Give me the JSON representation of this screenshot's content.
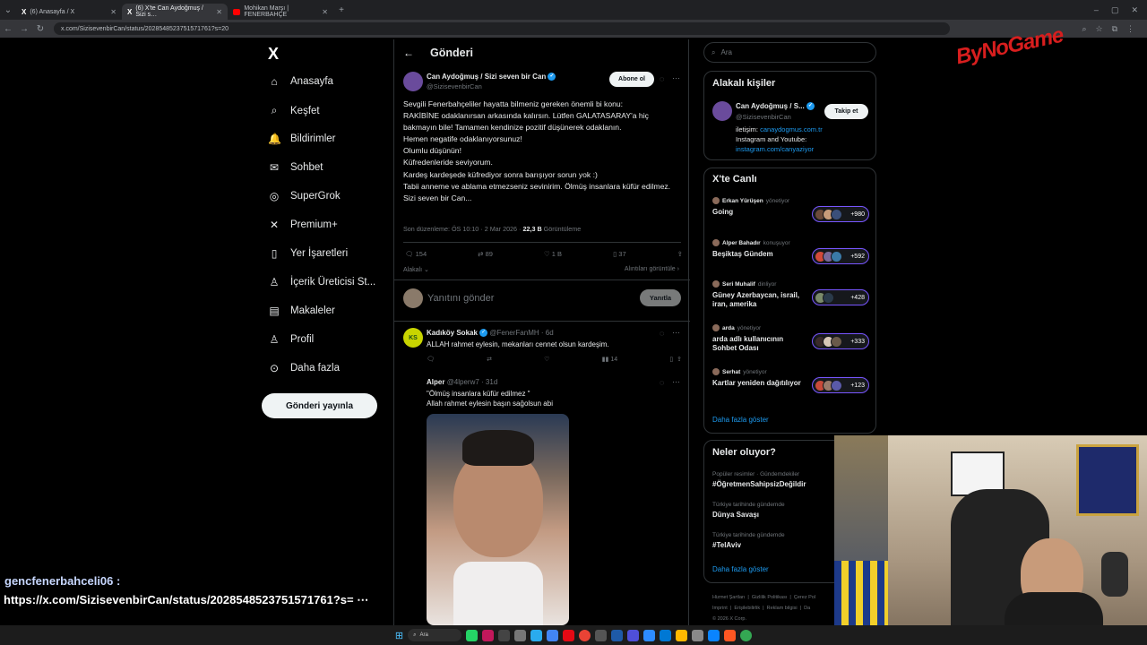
{
  "browser": {
    "tabs": [
      {
        "label": "(6) Anasayfa / X",
        "icon": "x-logo-icon",
        "active": false
      },
      {
        "label": "(6) X'te Can Aydoğmuş / Sizi s…",
        "icon": "x-logo-icon",
        "active": true
      },
      {
        "label": "Mohikan Marşı | FENERBAHÇE",
        "icon": "youtube-icon",
        "active": false
      }
    ],
    "new_tab": "+",
    "url": "x.com/SizisevenbirCan/status/2028548523751571761?s=20"
  },
  "sidebar": {
    "logo": "X",
    "items": [
      {
        "label": "Anasayfa",
        "icon": "home-icon",
        "glyph": "⌂"
      },
      {
        "label": "Keşfet",
        "icon": "search-icon",
        "glyph": "⌕"
      },
      {
        "label": "Bildirimler",
        "icon": "bell-icon",
        "glyph": "🔔"
      },
      {
        "label": "Sohbet",
        "icon": "mail-icon",
        "glyph": "✉"
      },
      {
        "label": "SuperGrok",
        "icon": "grok-icon",
        "glyph": "◎"
      },
      {
        "label": "Premium+",
        "icon": "premium-icon",
        "glyph": "✕"
      },
      {
        "label": "Yer İşaretleri",
        "icon": "bookmark-icon",
        "glyph": "▯"
      },
      {
        "label": "İçerik Üreticisi St...",
        "icon": "creator-icon",
        "glyph": "♙"
      },
      {
        "label": "Makaleler",
        "icon": "article-icon",
        "glyph": "▤"
      },
      {
        "label": "Profil",
        "icon": "profile-icon",
        "glyph": "♙"
      },
      {
        "label": "Daha fazla",
        "icon": "more-circle-icon",
        "glyph": "⊙"
      }
    ],
    "post_button": "Gönderi yayınla"
  },
  "main": {
    "header": {
      "back": "←",
      "title": "Gönderi"
    },
    "post": {
      "author": "Can Aydoğmuş / Sizi seven bir Can",
      "handle": "@SizisevenbirCan",
      "subscribe": "Abone ol",
      "body": "Sevgili Fenerbahçeliler hayatta bilmeniz gereken önemli bi konu:\nRAKİBİNE odaklanırsan arkasında kalırsın. Lütfen GALATASARAY'a hiç bakmayın bile! Tamamen kendinize pozitif düşünerek odaklanın.\nHemen negatife odaklanıyorsunuz!\nOlumlu düşünün!\nKüfredenleride seviyorum.\nKardeş kardeşede küfrediyor sonra barışıyor sorun yok :)\nTabii anneme ve ablama etmezseniz sevinirim. Ölmüş insanlara küfür edilmez.\nSizi seven bir Can...",
      "edited": "Son düzenleme: ÖS 10:10 · 2 Mar 2026 · ",
      "views_count": "22,3 B",
      "views_label": " Görüntüleme",
      "stats": {
        "replies": "154",
        "reposts": "89",
        "likes": "1 B",
        "bookmarks": "37"
      },
      "sort": "Alakalı",
      "quotes_link": "Alıntıları görüntüle"
    },
    "reply_box": {
      "placeholder": "Yanıtını gönder",
      "button": "Yanıtla"
    },
    "replies": [
      {
        "author": "Kadıköy Sokak",
        "handle": "@FenerFanMH · 6d",
        "text": "ALLAH rahmet eylesin, mekanları cennet olsun kardeşim.",
        "views": "14"
      },
      {
        "author": "Alper",
        "handle": "@4lperw7 · 31d",
        "text": "\"Ölmüş insanlara küfür edilmez \"\nAllah rahmet eylesin başın sağolsun abi"
      }
    ]
  },
  "right": {
    "search_placeholder": "Ara",
    "related": {
      "title": "Alakalı kişiler",
      "name": "Can Aydoğmuş / S...",
      "handle": "@SizisevenbirCan",
      "follow": "Takip et",
      "bio_prefix": "iletişim: ",
      "bio_link": "canaydogmus.com.tr",
      "bio_line2": "Instagram and Youtube:",
      "bio_link2": "instagram.com/canyaziyor"
    },
    "live": {
      "title": "X'te Canlı",
      "items": [
        {
          "host": "Erkan Yürüşen",
          "role": "yönetiyor",
          "title": "Going",
          "count": "+980"
        },
        {
          "host": "Alper Bahadır",
          "role": "konuşuyor",
          "title": "Beşiktaş Gündem",
          "count": "+592"
        },
        {
          "host": "Seri Muhalif",
          "role": "dinliyor",
          "title": "Güney Azerbaycan, israil, iran, amerika",
          "count": "+428"
        },
        {
          "host": "arda",
          "role": "yönetiyor",
          "title": "arda adlı kullanıcının Sohbet Odası",
          "count": "+333"
        },
        {
          "host": "Serhat",
          "role": "yönetiyor",
          "title": "Kartlar yeniden dağıtılıyor",
          "count": "+123"
        }
      ],
      "more": "Daha fazla göster"
    },
    "trends": {
      "title": "Neler oluyor?",
      "items": [
        {
          "meta": "Popüler resimler · Gündemdekiler",
          "tag": "#ÖğretmenSahipsizDeğildir"
        },
        {
          "meta": "Türkiye tarihinde gündemde",
          "tag": "Dünya Savaşı"
        },
        {
          "meta": "Türkiye tarihinde gündemde",
          "tag": "#TelAviv"
        }
      ],
      "more": "Daha fazla göster"
    },
    "footer": [
      "Hizmet Şartları",
      "Gizlilik Politikası",
      "Çerez Pol",
      "Imprint",
      "Erişilebilirlik",
      "Reklam bilgisi",
      "Da",
      "© 2026 X Corp."
    ]
  },
  "overlay": {
    "chat_user": "gencfenerbahceli06 :",
    "chat_msg": "https://x.com/SizisevenbirCan/status/2028548523751571761?s=",
    "watermark": "ByNoGame"
  },
  "taskbar": {
    "search": "Ara"
  },
  "colors": {
    "accent": "#1d9bf0",
    "live": "#7856ff",
    "bg": "#000000"
  }
}
